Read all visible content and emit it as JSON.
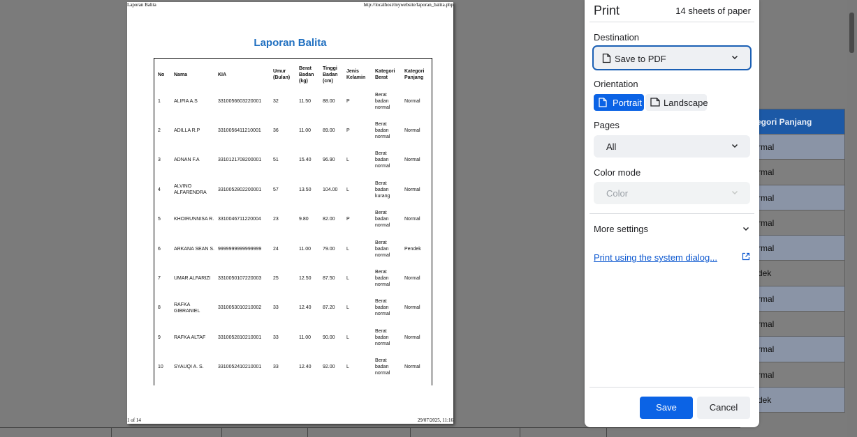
{
  "background_page": {
    "table_header": "egori Panjang",
    "column_values": [
      "rmal",
      "rmal",
      "rmal",
      "rmal",
      "rmal",
      "dek",
      "rmal",
      "rmal",
      "rmal",
      "rmal",
      "dek"
    ]
  },
  "preview": {
    "header_left": "Laporan Balita",
    "header_right": "http://localhost/mywebsite/laporan_balita.php",
    "footer_left": "1 of 14",
    "footer_right": "29/07/2025, 11:16",
    "report_title": "Laporan Balita",
    "columns": [
      "No",
      "Nama",
      "KIA",
      "Umur (Bulan)",
      "Berat Badan (kg)",
      "Tinggi Badan (cm)",
      "Jenis Kelamin",
      "Kategori Berat",
      "Kategori Panjang"
    ],
    "rows": [
      {
        "no": "1",
        "nama": "ALIFIA A.S",
        "kia": "3310056603220001",
        "umur": "32",
        "berat": "11.50",
        "tinggi": "88.00",
        "jk": "P",
        "kat_berat": "Berat badan normal",
        "kat_panjang": "Normal"
      },
      {
        "no": "2",
        "nama": "ADILLA R.P",
        "kia": "3310056411210001",
        "umur": "36",
        "berat": "11.00",
        "tinggi": "89.00",
        "jk": "P",
        "kat_berat": "Berat badan normal",
        "kat_panjang": "Normal"
      },
      {
        "no": "3",
        "nama": "ADNAN F.A",
        "kia": "3310121708200001",
        "umur": "51",
        "berat": "15.40",
        "tinggi": "96.90",
        "jk": "L",
        "kat_berat": "Berat badan normal",
        "kat_panjang": "Normal"
      },
      {
        "no": "4",
        "nama": "ALVINO ALFARENDRA",
        "kia": "3310052802200001",
        "umur": "57",
        "berat": "13.50",
        "tinggi": "104.00",
        "jk": "L",
        "kat_berat": "Berat badan kurang",
        "kat_panjang": "Normal"
      },
      {
        "no": "5",
        "nama": "KHOIRUNNISA R.",
        "kia": "3310046711220004",
        "umur": "23",
        "berat": "9.80",
        "tinggi": "82.00",
        "jk": "P",
        "kat_berat": "Berat badan normal",
        "kat_panjang": "Normal"
      },
      {
        "no": "6",
        "nama": "ARKANA SEAN S.",
        "kia": "9999999999999999",
        "umur": "24",
        "berat": "11.00",
        "tinggi": "79.00",
        "jk": "L",
        "kat_berat": "Berat badan normal",
        "kat_panjang": "Pendek"
      },
      {
        "no": "7",
        "nama": "UMAR ALFARIZI",
        "kia": "3310050107220003",
        "umur": "25",
        "berat": "12.50",
        "tinggi": "87.50",
        "jk": "L",
        "kat_berat": "Berat badan normal",
        "kat_panjang": "Normal"
      },
      {
        "no": "8",
        "nama": "RAFKA GIBRANIEL",
        "kia": "3310053010210002",
        "umur": "33",
        "berat": "12.40",
        "tinggi": "87.20",
        "jk": "L",
        "kat_berat": "Berat badan normal",
        "kat_panjang": "Normal"
      },
      {
        "no": "9",
        "nama": "RAFKA ALTAF",
        "kia": "3310052810210001",
        "umur": "33",
        "berat": "11.00",
        "tinggi": "90.00",
        "jk": "L",
        "kat_berat": "Berat badan normal",
        "kat_panjang": "Normal"
      },
      {
        "no": "10",
        "nama": "SYAUQI A. S.",
        "kia": "3310052410210001",
        "umur": "33",
        "berat": "12.40",
        "tinggi": "92.00",
        "jk": "L",
        "kat_berat": "Berat badan normal",
        "kat_panjang": "Normal"
      }
    ]
  },
  "dialog": {
    "title": "Print",
    "sheets": "14 sheets of paper",
    "destination_label": "Destination",
    "destination_value": "Save to PDF",
    "orientation_label": "Orientation",
    "portrait_label": "Portrait",
    "landscape_label": "Landscape",
    "pages_label": "Pages",
    "pages_value": "All",
    "color_mode_label": "Color mode",
    "color_mode_value": "Color",
    "more_settings": "More settings",
    "system_dialog_link": "Print using the system dialog...",
    "save_button": "Save",
    "cancel_button": "Cancel",
    "accent_color": "#0b63e5"
  }
}
